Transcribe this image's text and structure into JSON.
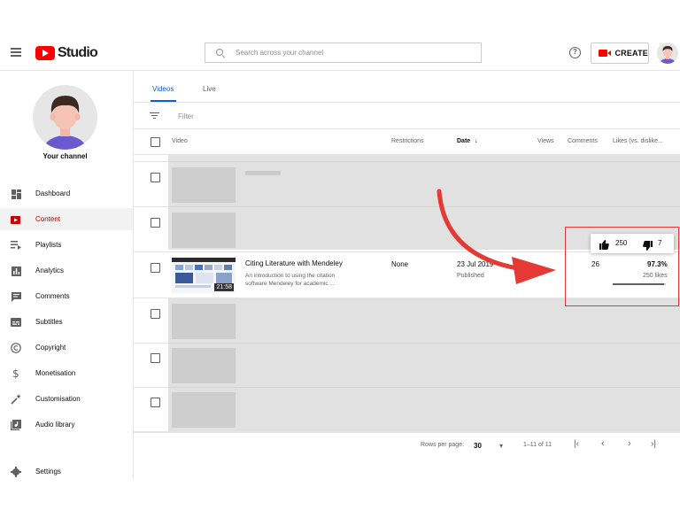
{
  "header": {
    "logo_text": "Studio",
    "search_placeholder": "Search across your channel",
    "help_glyph": "?",
    "create_label": "CREATE"
  },
  "sidebar": {
    "channel_label": "Your channel",
    "items": [
      {
        "label": "Dashboard",
        "icon": "dashboard-icon"
      },
      {
        "label": "Content",
        "icon": "content-icon",
        "active": true
      },
      {
        "label": "Playlists",
        "icon": "playlists-icon"
      },
      {
        "label": "Analytics",
        "icon": "analytics-icon"
      },
      {
        "label": "Comments",
        "icon": "comments-icon"
      },
      {
        "label": "Subtitles",
        "icon": "subtitles-icon"
      },
      {
        "label": "Copyright",
        "icon": "copyright-icon"
      },
      {
        "label": "Monetisation",
        "icon": "monetisation-icon"
      },
      {
        "label": "Customisation",
        "icon": "customisation-icon"
      },
      {
        "label": "Audio library",
        "icon": "audio-library-icon"
      }
    ],
    "settings_label": "Settings"
  },
  "tabs": [
    {
      "label": "Videos",
      "active": true
    },
    {
      "label": "Live"
    }
  ],
  "filter": {
    "label": "Filter"
  },
  "table": {
    "columns": {
      "video": "Video",
      "restrictions": "Restrictions",
      "date": "Date",
      "views": "Views",
      "comments": "Comments",
      "likes": "Likes (vs. dislike..."
    },
    "highlighted_row": {
      "title": "Citing Literature with Mendeley",
      "description": "An introduction to using the citation software Mendeley for academic ...",
      "duration": "21:58",
      "restrictions": "None",
      "date": "23 Jul 2019",
      "status": "Published",
      "comments": "26",
      "likes_percent": "97.3%",
      "likes_count": "250 likes",
      "likes_ratio": 0.973
    }
  },
  "likes_popup": {
    "likes": "250",
    "dislikes": "7"
  },
  "pager": {
    "rows_per_page_label": "Rows per page:",
    "rows_per_page_value": "30",
    "range": "1–11 of 11"
  },
  "colors": {
    "brand_red": "#ff0000",
    "active_text": "#cc0000",
    "tab_blue": "#065fd4",
    "annotation_red": "#e53935"
  }
}
